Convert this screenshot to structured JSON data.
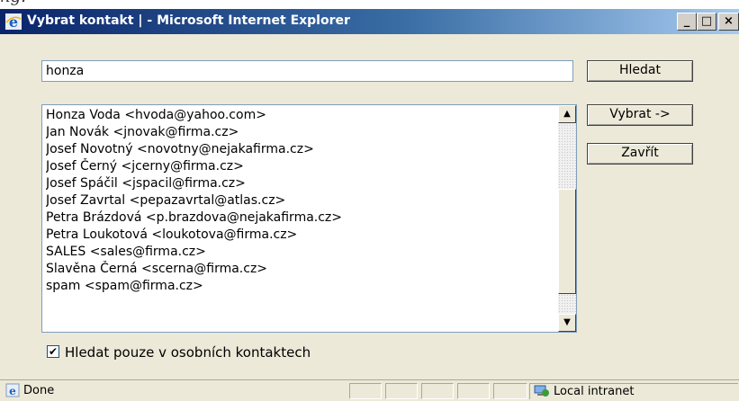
{
  "page_text_above": "ng.",
  "window": {
    "title": "Vybrat kontakt | - Microsoft Internet Explorer",
    "minimize_glyph": "_",
    "maximize_glyph": "□",
    "close_glyph": "×"
  },
  "search": {
    "value": "honza",
    "button_label": "Hledat"
  },
  "actions": {
    "select_label": "Vybrat ->",
    "close_label": "Zavřít"
  },
  "contacts": [
    "Honza Voda <hvoda@yahoo.com>",
    "Jan Novák <jnovak@firma.cz>",
    "Josef Novotný <novotny@nejakafirma.cz>",
    "Josef Černý <jcerny@firma.cz>",
    "Josef Spáčil <jspacil@firma.cz>",
    "Josef Zavrtal <pepazavrtal@atlas.cz>",
    "Petra Brázdová <p.brazdova@nejakafirma.cz>",
    "Petra Loukotová <loukotova@firma.cz>",
    "SALES <sales@firma.cz>",
    "Slavěna Černá <scerna@firma.cz>",
    "spam <spam@firma.cz>"
  ],
  "checkbox": {
    "label": "Hledat pouze v osobních kontaktech",
    "checked": true,
    "check_glyph": "✔"
  },
  "statusbar": {
    "status": "Done",
    "zone": "Local intranet"
  },
  "icons": {
    "title": "ie-icon",
    "status": "ie-page-icon",
    "zone": "local-intranet-icon",
    "scroll_up": "▲",
    "scroll_down": "▼"
  }
}
